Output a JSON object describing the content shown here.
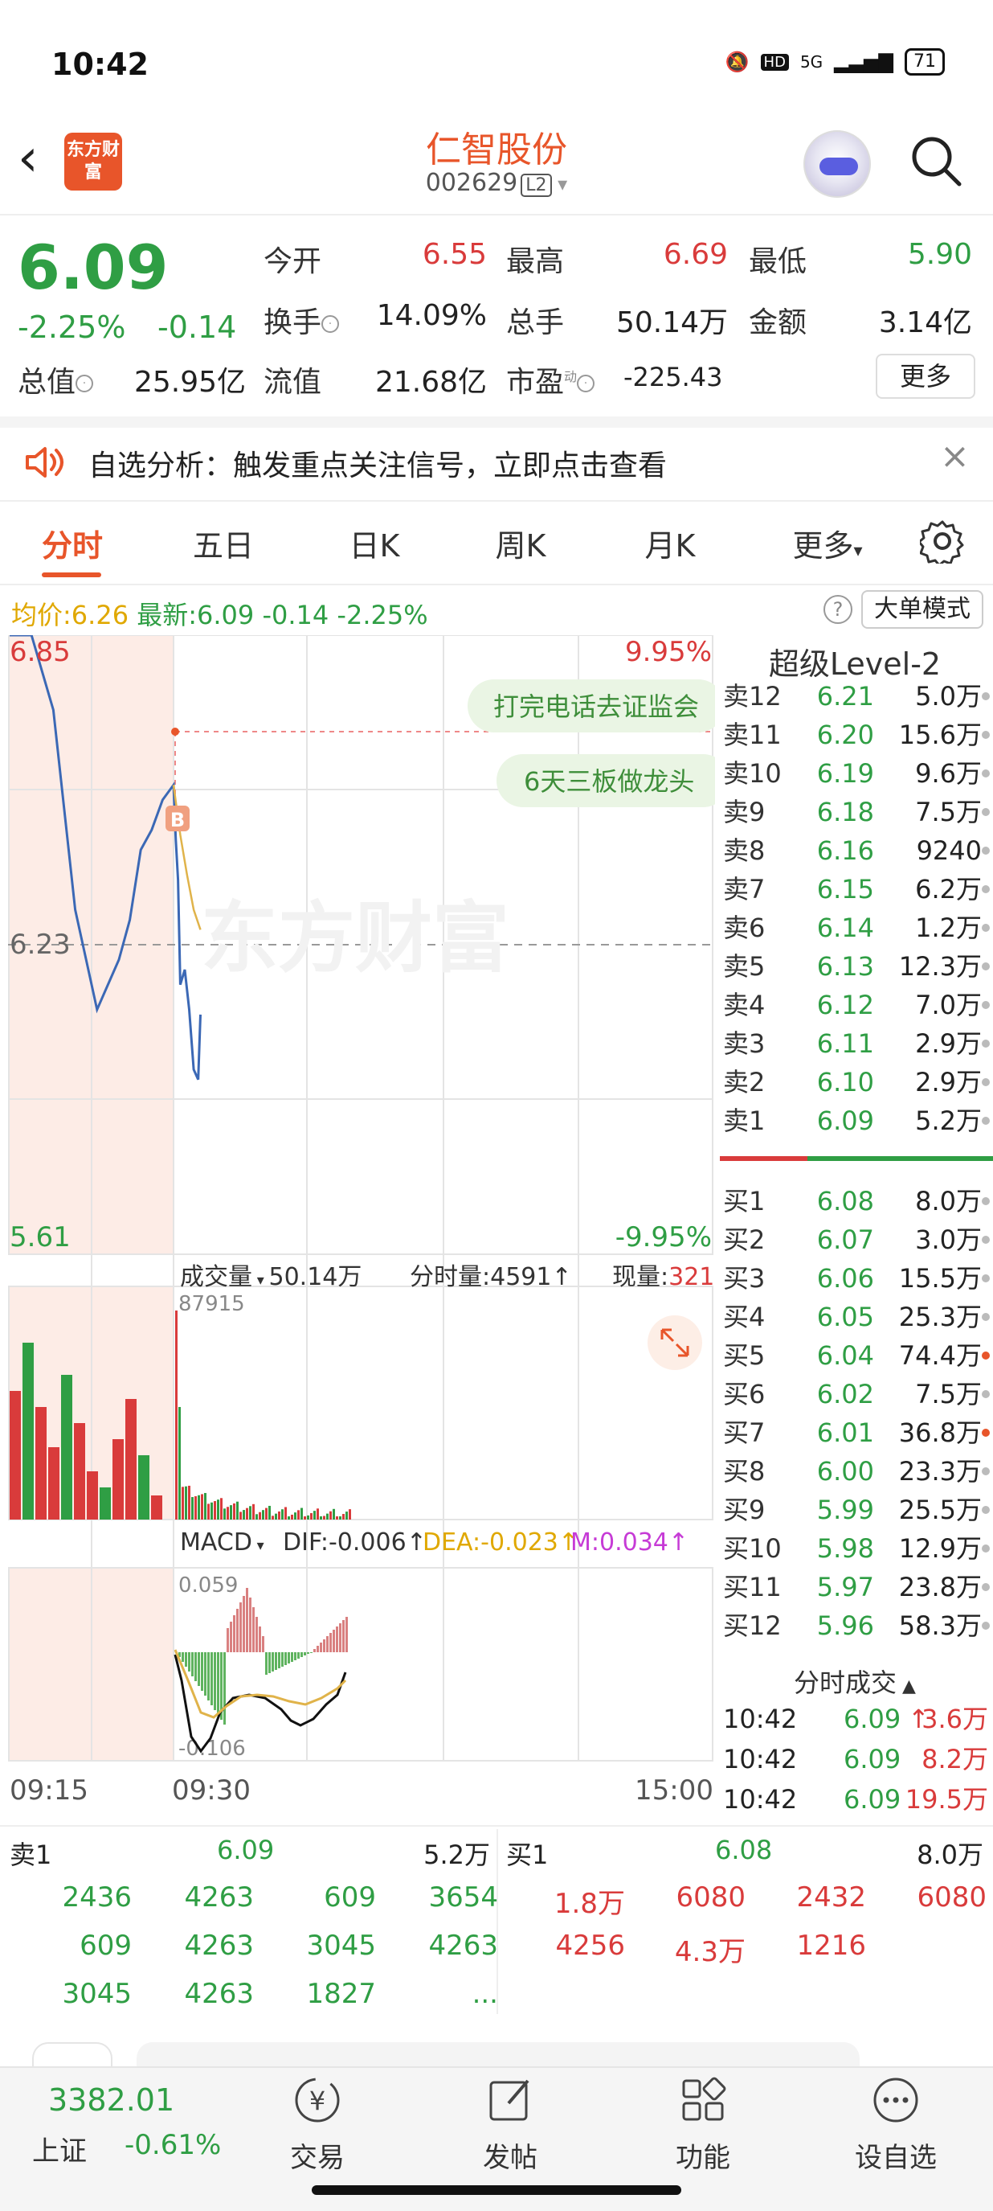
{
  "status": {
    "time": "10:42",
    "network": "5G",
    "hd": "HD",
    "battery": "71"
  },
  "header": {
    "logo_text": "东方财富",
    "stock_name": "仁智股份",
    "stock_code": "002629",
    "level_badge": "L2"
  },
  "quote": {
    "price": "6.09",
    "change_pct": "-2.25%",
    "change_val": "-0.14",
    "open_label": "今开",
    "open": "6.55",
    "high_label": "最高",
    "high": "6.69",
    "low_label": "最低",
    "low": "5.90",
    "turnover_label": "换手",
    "turnover": "14.09%",
    "volume_label": "总手",
    "volume": "50.14万",
    "amount_label": "金额",
    "amount": "3.14亿",
    "mktcap_label": "总值",
    "mktcap": "25.95亿",
    "float_label": "流值",
    "float": "21.68亿",
    "pe_label": "市盈",
    "pe_sup": "动",
    "pe": "-225.43",
    "more": "更多"
  },
  "alert": {
    "text": "自选分析：触发重点关注信号，立即点击查看"
  },
  "tabs": [
    "分时",
    "五日",
    "日K",
    "周K",
    "月K",
    "更多"
  ],
  "info_line": {
    "avg_label": "均价:",
    "avg": "6.26",
    "last_label": "最新:",
    "last": "6.09",
    "chg": "-0.14",
    "pct": "-2.25%"
  },
  "help": "?",
  "bigorder": "大单模式",
  "chart_labels": {
    "top_price": "6.85",
    "top_pct": "9.95%",
    "mid_price": "6.23",
    "bottom_price": "5.61",
    "bottom_pct": "-9.95%",
    "news1": "打完电话去证监会",
    "news2": "6天三板做龙头",
    "buy_marker": "B",
    "watermark": "东方财富",
    "vol_dropdown": "成交量",
    "vol_total": "50.14万",
    "vol_period_label": "分时量:",
    "vol_period": "4591",
    "vol_now_label": "现量:",
    "vol_now": "321",
    "vol_max": "87915",
    "macd_dropdown": "MACD",
    "dif_label": "DIF:",
    "dif": "-0.006",
    "dea_label": "DEA:",
    "dea": "-0.023",
    "m_label": "M:",
    "m": "0.034",
    "macd_max": "0.059",
    "macd_min": "-0.106",
    "t_start": "09:15",
    "t_open": "09:30",
    "t_end": "15:00"
  },
  "chart_data": {
    "type": "line",
    "x_range": [
      "09:15",
      "15:00"
    ],
    "ylim": [
      5.61,
      6.85
    ],
    "prev_close": 6.23,
    "series": [
      {
        "name": "最新",
        "x": [
          "09:15",
          "09:17",
          "09:19",
          "09:21",
          "09:23",
          "09:25",
          "09:26",
          "09:27",
          "09:28",
          "09:29",
          "09:30",
          "09:31",
          "09:32",
          "09:33",
          "09:35",
          "09:37",
          "09:39",
          "09:41",
          "09:42"
        ],
        "values": [
          6.85,
          6.85,
          6.7,
          6.3,
          6.1,
          6.2,
          6.28,
          6.42,
          6.46,
          6.52,
          6.55,
          6.44,
          6.36,
          6.15,
          6.18,
          6.1,
          5.98,
          5.96,
          6.09
        ]
      },
      {
        "name": "均价",
        "x": [
          "09:30",
          "09:33",
          "09:36",
          "09:39",
          "09:42"
        ],
        "values": [
          6.55,
          6.45,
          6.37,
          6.3,
          6.26
        ]
      }
    ]
  },
  "orderbook": {
    "title": "超级Level-2",
    "asks": [
      {
        "label": "卖12",
        "price": "6.21",
        "vol": "5.0万"
      },
      {
        "label": "卖11",
        "price": "6.20",
        "vol": "15.6万"
      },
      {
        "label": "卖10",
        "price": "6.19",
        "vol": "9.6万"
      },
      {
        "label": "卖9",
        "price": "6.18",
        "vol": "7.5万"
      },
      {
        "label": "卖8",
        "price": "6.16",
        "vol": "9240"
      },
      {
        "label": "卖7",
        "price": "6.15",
        "vol": "6.2万"
      },
      {
        "label": "卖6",
        "price": "6.14",
        "vol": "1.2万"
      },
      {
        "label": "卖5",
        "price": "6.13",
        "vol": "12.3万"
      },
      {
        "label": "卖4",
        "price": "6.12",
        "vol": "7.0万"
      },
      {
        "label": "卖3",
        "price": "6.11",
        "vol": "2.9万"
      },
      {
        "label": "卖2",
        "price": "6.10",
        "vol": "2.9万"
      },
      {
        "label": "卖1",
        "price": "6.09",
        "vol": "5.2万"
      }
    ],
    "bids": [
      {
        "label": "买1",
        "price": "6.08",
        "vol": "8.0万"
      },
      {
        "label": "买2",
        "price": "6.07",
        "vol": "3.0万"
      },
      {
        "label": "买3",
        "price": "6.06",
        "vol": "15.5万"
      },
      {
        "label": "买4",
        "price": "6.05",
        "vol": "25.3万"
      },
      {
        "label": "买5",
        "price": "6.04",
        "vol": "74.4万"
      },
      {
        "label": "买6",
        "price": "6.02",
        "vol": "7.5万"
      },
      {
        "label": "买7",
        "price": "6.01",
        "vol": "36.8万"
      },
      {
        "label": "买8",
        "price": "6.00",
        "vol": "23.3万"
      },
      {
        "label": "买9",
        "price": "5.99",
        "vol": "25.5万"
      },
      {
        "label": "买10",
        "price": "5.98",
        "vol": "12.9万"
      },
      {
        "label": "买11",
        "price": "5.97",
        "vol": "23.8万"
      },
      {
        "label": "买12",
        "price": "5.96",
        "vol": "58.3万"
      }
    ],
    "ticks_title": "分时成交",
    "ticks": [
      {
        "time": "10:42",
        "price": "6.09",
        "vol": "3.6万"
      },
      {
        "time": "10:42",
        "price": "6.09",
        "vol": "8.2万"
      },
      {
        "time": "10:42",
        "price": "6.09",
        "vol": "19.5万"
      }
    ]
  },
  "bottom_book": {
    "sell_label": "卖1",
    "sell_price": "6.09",
    "sell_vol": "5.2万",
    "buy_label": "买1",
    "buy_price": "6.08",
    "buy_vol": "8.0万",
    "sell_queue": [
      "2436",
      "4263",
      "609",
      "3654",
      "609",
      "4263",
      "3045",
      "4263",
      "3045",
      "4263",
      "1827",
      "..."
    ],
    "buy_queue": [
      "1.8万",
      "6080",
      "2432",
      "6080",
      "4256",
      "4.3万",
      "1216"
    ]
  },
  "nav": {
    "index_value": "3382.01",
    "index_name": "上证",
    "index_change": "-0.61%",
    "items": [
      "交易",
      "发帖",
      "功能",
      "设自选"
    ]
  },
  "colors": {
    "accent": "#e8552a",
    "up": "#d93b3b",
    "down": "#2f9e44"
  }
}
